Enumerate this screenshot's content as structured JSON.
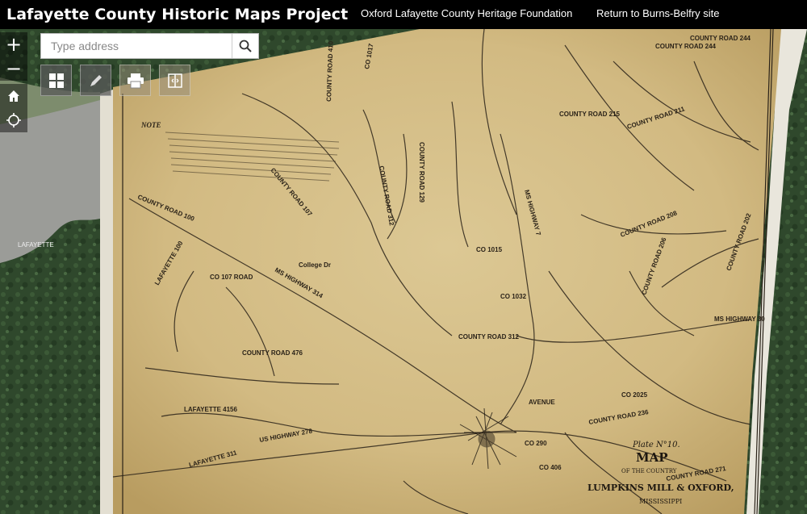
{
  "header": {
    "title": "Lafayette County Historic Maps Project",
    "foundation_link": "Oxford Lafayette County Heritage Foundation",
    "return_link": "Return to Burns-Belfry site"
  },
  "search": {
    "placeholder": "Type address"
  },
  "zoom": {
    "in_label": "+",
    "out_label": "−"
  },
  "toolbar": {
    "items": [
      {
        "icon": "grid-icon"
      },
      {
        "icon": "pencil-icon"
      },
      {
        "icon": "print-icon"
      },
      {
        "icon": "swipe-icon"
      }
    ]
  },
  "map_labels": {
    "note": "NOTE",
    "county_road_244_a": "COUNTY ROAD 244",
    "county_road_244_b": "COUNTY ROAD 244",
    "county_road_215": "COUNTY ROAD 215",
    "county_road_211": "COUNTY ROAD 211",
    "county_road_100": "COUNTY ROAD 100",
    "county_road_107": "COUNTY ROAD 107",
    "county_road_129": "COUNTY ROAD 129",
    "county_road_208": "COUNTY ROAD 208",
    "county_road_202": "COUNTY ROAD 202",
    "county_road_206": "COUNTY ROAD 206",
    "county_road_312": "COUNTY ROAD 312",
    "county_road_476": "COUNTY ROAD 476",
    "county_road_236": "COUNTY ROAD 236",
    "county_road_271": "COUNTY ROAD 271",
    "co_107_road": "CO 107 ROAD",
    "co_1017": "CO 1017",
    "co_1015": "CO 1015",
    "co_1032": "CO 1032",
    "co_2025": "CO 2025",
    "co_406": "CO 406",
    "co_290": "CO 290",
    "lafayette_100": "LAFAYETTE 100",
    "lafayette_4156": "LAFAYETTE 4156",
    "lafayette_311": "LAFAYETTE 311",
    "ms_highway_314": "MS HIGHWAY 314",
    "ms_highway_7": "MS HIGHWAY 7",
    "ms_highway_30": "MS HIGHWAY 30",
    "us_highway_278": "US HIGHWAY 278",
    "college_dr": "College Dr",
    "avenue": "AVENUE",
    "county_road_410": "COUNTY ROAD 410",
    "county_road_312b": "COUNTY ROAD 312",
    "lake_label": "LAFAYETTE",
    "plate_text": "Plate N°10.",
    "map_title": "MAP",
    "map_sub": "OF THE COUNTRY",
    "map_place": "LUMPKINS MILL & OXFORD,",
    "map_state": "MISSISSIPPI"
  },
  "colors": {
    "paper": "#d7c18d",
    "paper_dark": "#b59a5c",
    "forest": "#2f4a2e",
    "water": "#9a9a95",
    "ink": "#2a2218"
  }
}
